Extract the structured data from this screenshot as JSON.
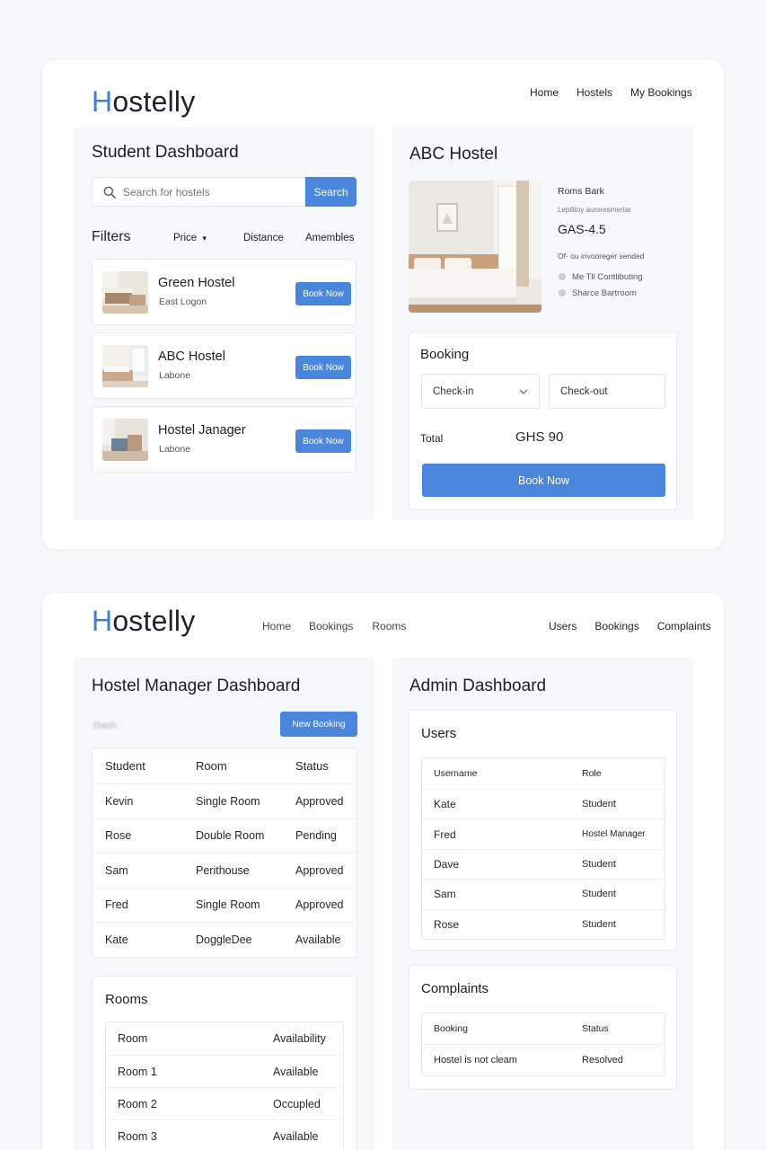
{
  "student_view": {
    "brand": {
      "first": "H",
      "rest": "ostelly"
    },
    "nav": [
      "Home",
      "Hostels",
      "My Bookings"
    ],
    "dashboard": {
      "title": "Student Dashboard",
      "search": {
        "placeholder": "Search for hostels",
        "button": "Search",
        "icon": "search-icon"
      },
      "filters": {
        "label": "Filters",
        "price": "Price",
        "price_icon": "caret-down",
        "distance": "Distance",
        "amenities": "Amembles"
      },
      "hostels": [
        {
          "name": "Green Hostel",
          "location": "East Logon",
          "button": "Book Now"
        },
        {
          "name": "ABC Hostel",
          "location": "Labone",
          "button": "Book Now"
        },
        {
          "name": "Hostel Janager",
          "location": "Labone",
          "button": "Book Now"
        }
      ]
    },
    "detail": {
      "title": "ABC Hostel",
      "room_name": "Roms Bark",
      "subtitle": "Lepilitoy auroresmertar",
      "price": "GAS-4.5",
      "note": "Of· ou invooreger sended",
      "features": [
        "Me Tll Contlibuting",
        "Sharce Bartroom"
      ],
      "booking": {
        "title": "Booking",
        "checkin": "Check-in",
        "checkout": "Check-out",
        "total_label": "Total",
        "total_value": "GHS 90",
        "button": "Book Now"
      }
    }
  },
  "manager_view": {
    "brand": {
      "first": "H",
      "rest": "ostelly"
    },
    "nav_left": [
      "Home",
      "Bookings",
      "Rooms"
    ],
    "nav_right": [
      "Users",
      "Bookings",
      "Complaints"
    ],
    "manager": {
      "title": "Hostel Manager Dashboard",
      "faded_text": "Dash",
      "new_booking": "New Booking",
      "bookings_table": {
        "headers": [
          "Student",
          "Room",
          "Status"
        ],
        "rows": [
          [
            "Kevin",
            "Single Room",
            "Approved"
          ],
          [
            "Rose",
            "Double Room",
            "Pending"
          ],
          [
            "Sam",
            "Perithouse",
            "Approved"
          ],
          [
            "Fred",
            "Single Room",
            "Approved"
          ],
          [
            "Kate",
            "DoggleDee",
            "Available"
          ]
        ]
      },
      "rooms": {
        "title": "Rooms",
        "headers": [
          "Room",
          "Availability"
        ],
        "rows": [
          [
            "Room 1",
            "Available"
          ],
          [
            "Room 2",
            "Occupled"
          ],
          [
            "Room 3",
            "Available"
          ]
        ]
      }
    },
    "admin": {
      "title": "Admin Dashboard",
      "users": {
        "title": "Users",
        "headers": [
          "Username",
          "Role"
        ],
        "rows": [
          [
            "Kate",
            "Student"
          ],
          [
            "Fred",
            "Hostel Manager"
          ],
          [
            "Dave",
            "Student"
          ],
          [
            "Sam",
            "Student"
          ],
          [
            "Rose",
            "Student"
          ]
        ]
      },
      "complaints": {
        "title": "Complaints",
        "headers": [
          "Booking",
          "Status"
        ],
        "rows": [
          [
            "Hostel is not cleam",
            "Resolved"
          ]
        ]
      }
    }
  },
  "colors": {
    "accent": "#4a86dc",
    "logo_h": "#3f7ed8"
  }
}
